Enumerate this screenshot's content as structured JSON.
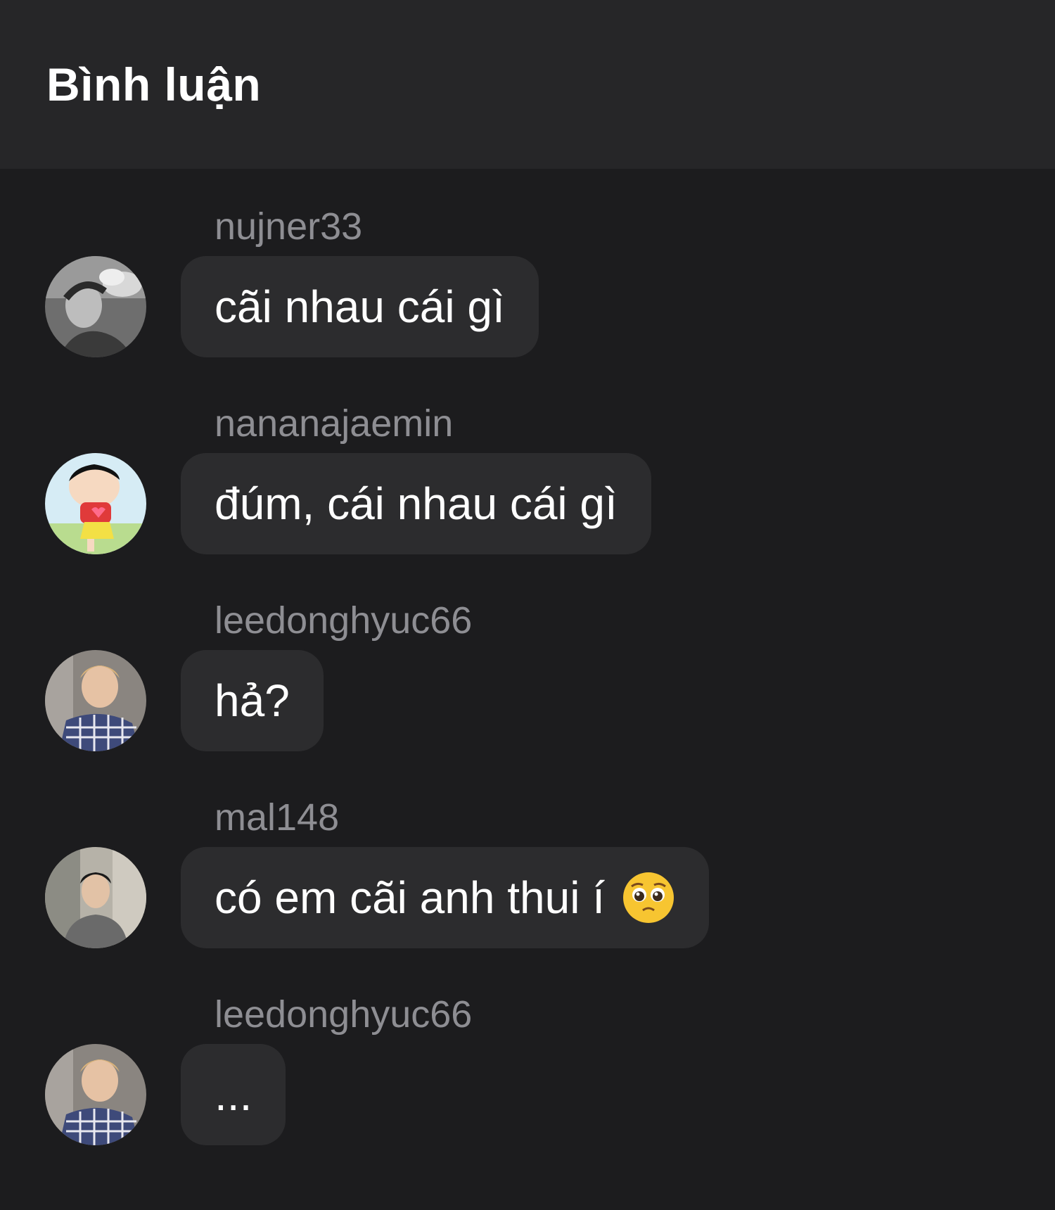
{
  "header": {
    "title": "Bình luận"
  },
  "comments": [
    {
      "username": "nujner33",
      "text": "cãi nhau cái gì"
    },
    {
      "username": "nananajaemin",
      "text": "đúm, cái nhau cái gì"
    },
    {
      "username": "leedonghyuc66",
      "text": "hả?"
    },
    {
      "username": "mal148",
      "text": "có em cãi anh thui í",
      "emoji": "pleading-face-emoji"
    },
    {
      "username": "leedonghyuc66",
      "text": "..."
    }
  ],
  "colors": {
    "background": "#1c1c1e",
    "header_background": "#262628",
    "bubble": "#2c2c2e",
    "username": "#8e8e93",
    "text": "#ffffff"
  }
}
